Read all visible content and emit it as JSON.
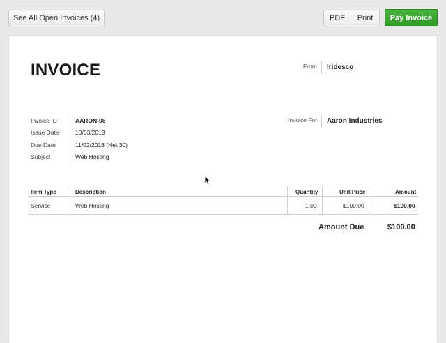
{
  "toolbar": {
    "open_invoices_label": "See All Open Invoices (4)",
    "pdf_label": "PDF",
    "print_label": "Print",
    "pay_label": "Pay Invoice"
  },
  "invoice": {
    "title": "INVOICE",
    "from_label": "From",
    "from_value": "Iridesco",
    "for_label": "Invoice For",
    "for_value": "Aaron Industries",
    "meta": [
      {
        "label": "Invoice ID",
        "value": "AARON-06"
      },
      {
        "label": "Issue Date",
        "value": "10/03/2018"
      },
      {
        "label": "Due Date",
        "value": "11/02/2018 (Net 30)"
      },
      {
        "label": "Subject",
        "value": "Web Hosting"
      }
    ],
    "table": {
      "headers": [
        "Item Type",
        "Description",
        "Quantity",
        "Unit Price",
        "Amount"
      ],
      "rows": [
        {
          "item_type": "Service",
          "description": "Web Hosting",
          "quantity": "1.00",
          "unit_price": "$100.00",
          "amount": "$100.00"
        }
      ]
    },
    "amount_due_label": "Amount Due",
    "amount_due_value": "$100.00"
  }
}
